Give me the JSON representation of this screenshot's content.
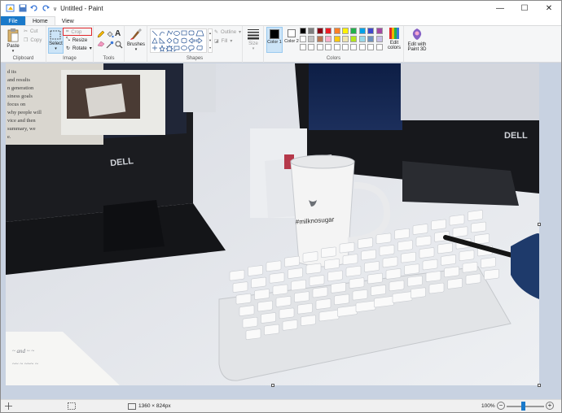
{
  "window": {
    "title": "Untitled - Paint",
    "controls": {
      "minimize": "—",
      "maximize": "☐",
      "close": "✕"
    }
  },
  "quick_access": {
    "icons": [
      "paint-icon",
      "save-icon",
      "undo-icon",
      "redo-icon",
      "customize-icon"
    ],
    "customize": "∨"
  },
  "tabs": [
    {
      "label": "File"
    },
    {
      "label": "Home"
    },
    {
      "label": "View"
    }
  ],
  "ribbon": {
    "clipboard": {
      "paste": "Paste",
      "cut": "Cut",
      "copy": "Copy",
      "label": "Clipboard"
    },
    "image": {
      "select": "Select",
      "crop": "Crop",
      "resize": "Resize",
      "rotate": "Rotate",
      "label": "Image"
    },
    "tools": {
      "label": "Tools"
    },
    "brushes": {
      "label": "Brushes"
    },
    "shapes": {
      "outline": "Outline",
      "fill": "Fill",
      "label": "Shapes"
    },
    "size": {
      "label": "Size"
    },
    "colors": {
      "color1": "Color 1",
      "color2": "Color 2",
      "edit_colors": "Edit colors",
      "label": "Colors",
      "row1": [
        "#000000",
        "#7f7f7f",
        "#880015",
        "#ed1c24",
        "#ff7f27",
        "#fff200",
        "#22b14c",
        "#00a2e8",
        "#3f48cc",
        "#a349a4"
      ],
      "row2": [
        "#ffffff",
        "#c3c3c3",
        "#b97a57",
        "#ffaec9",
        "#ffc90e",
        "#efe4b0",
        "#b5e61d",
        "#99d9ea",
        "#7092be",
        "#c8bfe7"
      ],
      "row3": [
        "#ffffff",
        "#ffffff",
        "#ffffff",
        "#ffffff",
        "#ffffff",
        "#ffffff",
        "#ffffff",
        "#ffffff",
        "#ffffff",
        "#ffffff"
      ]
    },
    "paint3d": {
      "label": "Edit with Paint 3D"
    }
  },
  "canvas": {
    "mug_text": "#milknosugar",
    "monitor_brand": "DELL",
    "paper_text": [
      "d its",
      "and results",
      "n generation",
      "siness goals",
      "focus on",
      "why people will",
      "vice and then",
      "summary, we",
      "e."
    ]
  },
  "status": {
    "dimensions": "1360 × 824px",
    "zoom": "100%"
  }
}
